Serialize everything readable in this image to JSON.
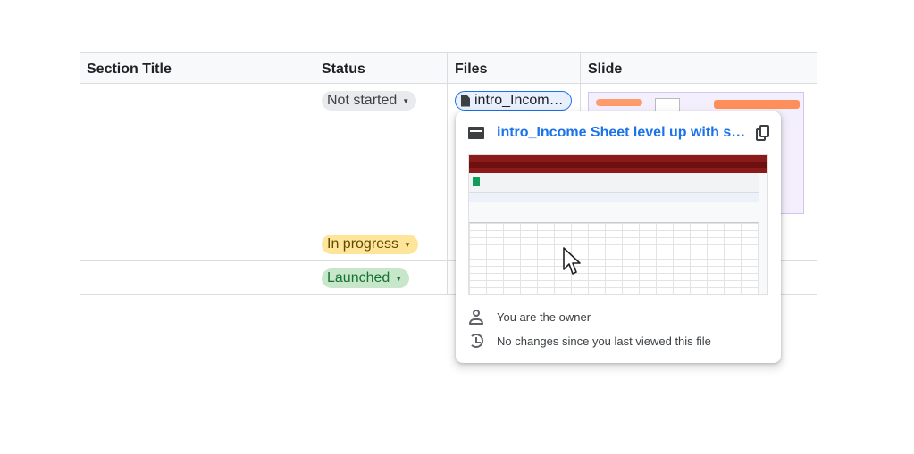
{
  "table": {
    "headers": [
      "Section Title",
      "Status",
      "Files",
      "Slide"
    ],
    "rows": [
      {
        "status": "Not started",
        "file": "intro_Incom…"
      },
      {
        "status": "In progress"
      },
      {
        "status": "Launched"
      }
    ]
  },
  "status_colors": {
    "not_started": "#e8eaed",
    "in_progress": "#ffe599",
    "launched": "#c8e6c9"
  },
  "card": {
    "title": "intro_Income Sheet level up with s…",
    "owner_text": "You are the owner",
    "changes_text": "No changes since you last viewed this file"
  },
  "icons": {
    "file_chip": "document-icon",
    "card_type": "video-file-icon",
    "copy": "copy-link-icon",
    "owner": "person-icon",
    "changes": "history-icon",
    "pointer": "mouse-cursor-icon"
  },
  "accent": "#1a73e8"
}
